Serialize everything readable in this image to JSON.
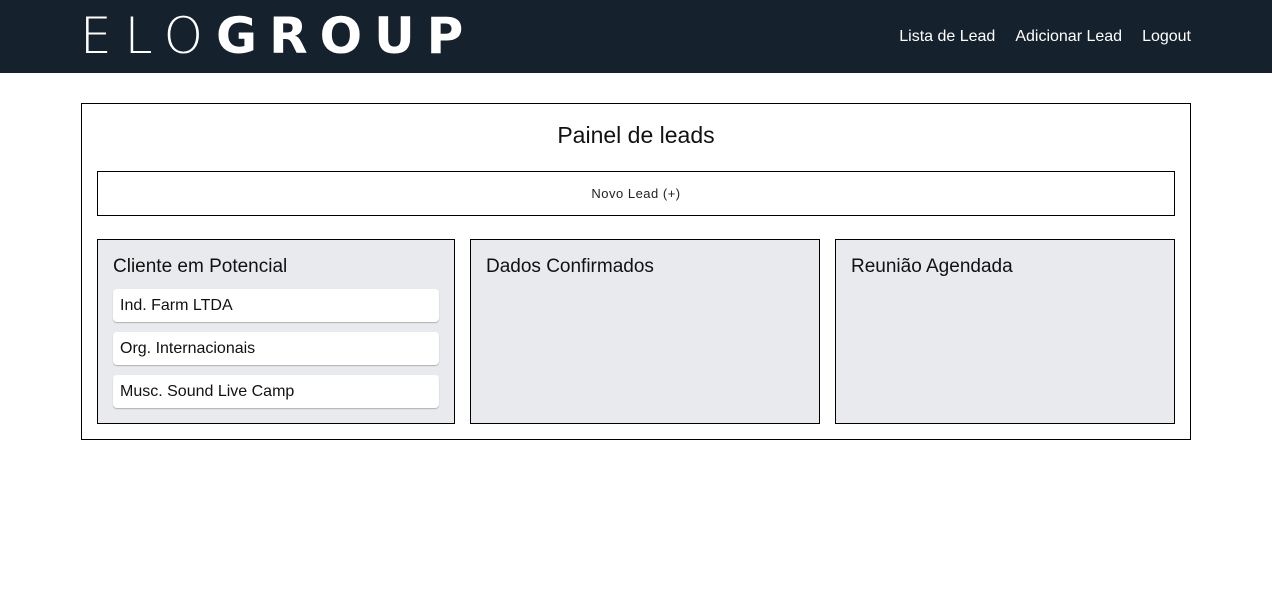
{
  "header": {
    "logo_light": "ELO",
    "logo_bold": "GROUP",
    "nav": [
      "Lista de Lead",
      "Adicionar Lead",
      "Logout"
    ]
  },
  "panel": {
    "title": "Painel de leads",
    "new_lead_label": "Novo Lead (+)",
    "columns": [
      {
        "title": "Cliente em Potencial",
        "cards": [
          "Ind. Farm LTDA",
          "Org. Internacionais",
          "Musc. Sound Live Camp"
        ]
      },
      {
        "title": "Dados Confirmados",
        "cards": []
      },
      {
        "title": "Reunião Agendada",
        "cards": []
      }
    ]
  },
  "colors": {
    "navbar": "#15212c",
    "column_bg": "#e9eaee",
    "card_bg": "#ffffff"
  }
}
